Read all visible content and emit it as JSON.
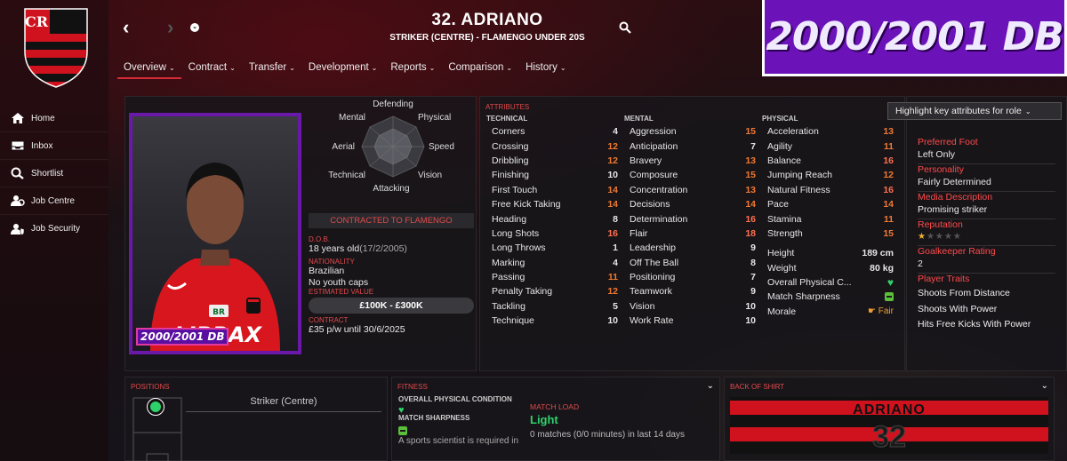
{
  "sidebar": {
    "items": [
      {
        "label": "Home",
        "icon": "home-icon"
      },
      {
        "label": "Inbox",
        "icon": "inbox-icon"
      },
      {
        "label": "Shortlist",
        "icon": "search-icon"
      },
      {
        "label": "Job Centre",
        "icon": "job-centre-icon"
      },
      {
        "label": "Job Security",
        "icon": "job-security-icon"
      }
    ]
  },
  "header": {
    "player_name": "32. ADRIANO",
    "subtitle": "STRIKER (CENTRE) - FLAMENGO UNDER 20S",
    "tabs": [
      {
        "label": "Overview"
      },
      {
        "label": "Contract"
      },
      {
        "label": "Transfer"
      },
      {
        "label": "Development"
      },
      {
        "label": "Reports"
      },
      {
        "label": "Comparison"
      },
      {
        "label": "History"
      }
    ]
  },
  "banner": {
    "text": "2000/2001 DB"
  },
  "profile": {
    "photo_tag": "2000/2001 DB",
    "radar_labels": {
      "defending": "Defending",
      "physical": "Physical",
      "speed": "Speed",
      "vision": "Vision",
      "attacking": "Attacking",
      "technical": "Technical",
      "aerial": "Aerial",
      "mental": "Mental"
    },
    "contract_status": "CONTRACTED TO FLAMENGO",
    "dob_label": "D.O.B.",
    "dob_value": "18 years old",
    "dob_date": "(17/2/2005)",
    "nationality_label": "NATIONALITY",
    "nationality_value": "Brazilian",
    "caps_value": "No youth caps",
    "value_label": "ESTIMATED VALUE",
    "value_value": "£100K - £300K",
    "contract_label": "CONTRACT",
    "contract_value": "£35 p/w until 30/6/2025"
  },
  "attributes": {
    "section_label": "ATTRIBUTES",
    "highlight_select": "Highlight key attributes for role",
    "technical_header": "TECHNICAL",
    "mental_header": "MENTAL",
    "physical_header": "PHYSICAL",
    "technical": [
      {
        "name": "Corners",
        "value": "4",
        "tone": ""
      },
      {
        "name": "Crossing",
        "value": "12",
        "tone": "o"
      },
      {
        "name": "Dribbling",
        "value": "12",
        "tone": "o"
      },
      {
        "name": "Finishing",
        "value": "10",
        "tone": ""
      },
      {
        "name": "First Touch",
        "value": "14",
        "tone": "o"
      },
      {
        "name": "Free Kick Taking",
        "value": "14",
        "tone": "o"
      },
      {
        "name": "Heading",
        "value": "8",
        "tone": ""
      },
      {
        "name": "Long Shots",
        "value": "16",
        "tone": "r"
      },
      {
        "name": "Long Throws",
        "value": "1",
        "tone": ""
      },
      {
        "name": "Marking",
        "value": "4",
        "tone": ""
      },
      {
        "name": "Passing",
        "value": "11",
        "tone": "o"
      },
      {
        "name": "Penalty Taking",
        "value": "12",
        "tone": "o"
      },
      {
        "name": "Tackling",
        "value": "5",
        "tone": ""
      },
      {
        "name": "Technique",
        "value": "10",
        "tone": ""
      }
    ],
    "mental": [
      {
        "name": "Aggression",
        "value": "15",
        "tone": "o"
      },
      {
        "name": "Anticipation",
        "value": "7",
        "tone": ""
      },
      {
        "name": "Bravery",
        "value": "13",
        "tone": "o"
      },
      {
        "name": "Composure",
        "value": "15",
        "tone": "o"
      },
      {
        "name": "Concentration",
        "value": "13",
        "tone": "o"
      },
      {
        "name": "Decisions",
        "value": "14",
        "tone": "o"
      },
      {
        "name": "Determination",
        "value": "16",
        "tone": "r"
      },
      {
        "name": "Flair",
        "value": "18",
        "tone": "r"
      },
      {
        "name": "Leadership",
        "value": "9",
        "tone": ""
      },
      {
        "name": "Off The Ball",
        "value": "8",
        "tone": ""
      },
      {
        "name": "Positioning",
        "value": "7",
        "tone": ""
      },
      {
        "name": "Teamwork",
        "value": "9",
        "tone": ""
      },
      {
        "name": "Vision",
        "value": "10",
        "tone": ""
      },
      {
        "name": "Work Rate",
        "value": "10",
        "tone": ""
      }
    ],
    "physical": [
      {
        "name": "Acceleration",
        "value": "13",
        "tone": "o"
      },
      {
        "name": "Agility",
        "value": "11",
        "tone": "o"
      },
      {
        "name": "Balance",
        "value": "16",
        "tone": "r"
      },
      {
        "name": "Jumping Reach",
        "value": "12",
        "tone": "o"
      },
      {
        "name": "Natural Fitness",
        "value": "16",
        "tone": "r"
      },
      {
        "name": "Pace",
        "value": "14",
        "tone": "o"
      },
      {
        "name": "Stamina",
        "value": "11",
        "tone": "o"
      },
      {
        "name": "Strength",
        "value": "15",
        "tone": "o"
      }
    ],
    "height_label": "Height",
    "height_value": "189 cm",
    "weight_label": "Weight",
    "weight_value": "80 kg",
    "overall_label": "Overall Physical C...",
    "sharpness_label": "Match Sharpness",
    "morale_label": "Morale",
    "morale_value": "Fair"
  },
  "info": {
    "preferred_foot_label": "Preferred Foot",
    "preferred_foot_value": "Left Only",
    "personality_label": "Personality",
    "personality_value": "Fairly Determined",
    "media_label": "Media Description",
    "media_value": "Promising striker",
    "reputation_label": "Reputation",
    "reputation_stars": 0.5,
    "gk_label": "Goalkeeper Rating",
    "gk_value": "2",
    "traits_label": "Player Traits",
    "traits": [
      "Shoots From Distance",
      "Shoots With Power",
      "Hits Free Kicks With Power"
    ]
  },
  "positions": {
    "label": "POSITIONS",
    "position": "Striker (Centre)"
  },
  "fitness": {
    "label": "FITNESS",
    "overall_label": "OVERALL PHYSICAL CONDITION",
    "sharpness_label": "MATCH SHARPNESS",
    "note": "A sports scientist is required in",
    "load_label": "MATCH LOAD",
    "load_value": "Light",
    "load_detail": "0 matches (0/0 minutes) in last 14 days"
  },
  "shirt": {
    "label": "BACK OF SHIRT",
    "name": "ADRIANO",
    "number": "32"
  },
  "colors": {
    "accent": "#d62b36",
    "banner": "#6b12b8",
    "good": "#2fd16a"
  }
}
